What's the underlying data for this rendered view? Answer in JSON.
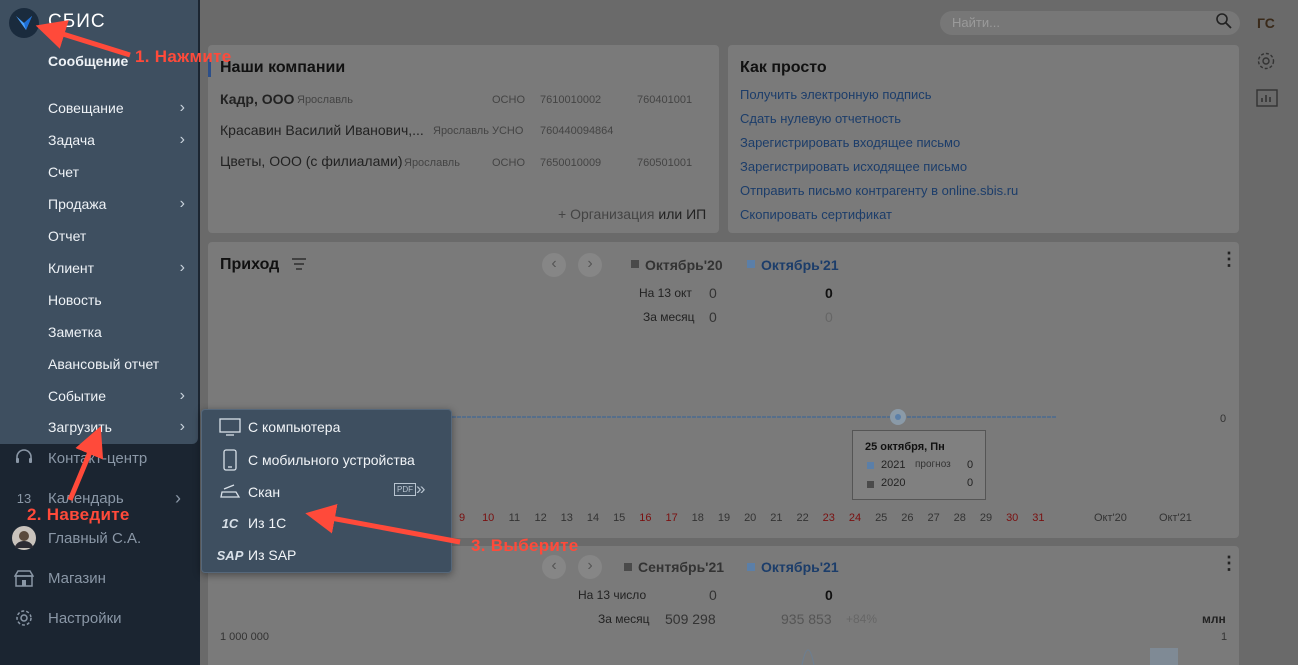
{
  "app": {
    "brand": "СБИС",
    "user_initials": "ГС",
    "search_placeholder": "Найти..."
  },
  "companies": {
    "title": "Наши компании",
    "rows": [
      {
        "name": "Кадр, ООО",
        "city": "Ярославль",
        "tax": "ОСНО",
        "inn": "7610010002",
        "kpp": "760401001"
      },
      {
        "name": "Красавин Василий Иванович,...",
        "city": "Ярославль",
        "tax": "УСНО",
        "inn": "760440094864",
        "kpp": ""
      },
      {
        "name": "Цветы, ООО (с филиалами)",
        "city": "Ярославль",
        "tax": "ОСНО",
        "inn": "7650010009",
        "kpp": "760501001"
      }
    ],
    "add_label": "+ Организация",
    "add_suffix": "или ИП"
  },
  "howto": {
    "title": "Как просто",
    "links": [
      "Получить электронную подпись",
      "Сдать нулевую отчетность",
      "Зарегистрировать входящее письмо",
      "Зарегистрировать исходящее письмо",
      "Отправить письмо контрагенту в online.sbis.ru",
      "Скопировать сертификат"
    ]
  },
  "income": {
    "title": "Приход",
    "col_prev": "Октябрь'20",
    "col_cur": "Октябрь'21",
    "row1_label": "На 13 окт",
    "row1_prev": "0",
    "row1_cur": "0",
    "row2_label": "За месяц",
    "row2_prev": "0",
    "row2_cur": "0",
    "axis_right": "0",
    "tooltip": {
      "title": "25 октября, Пн",
      "r1_year": "2021",
      "r1_note": "прогноз",
      "r1_val": "0",
      "r2_year": "2020",
      "r2_val": "0"
    },
    "days": [
      "9",
      "10",
      "11",
      "12",
      "13",
      "14",
      "15",
      "16",
      "17",
      "18",
      "19",
      "20",
      "21",
      "22",
      "23",
      "24",
      "25",
      "26",
      "27",
      "28",
      "29",
      "30",
      "31"
    ],
    "weekend_days": [
      "9",
      "10",
      "16",
      "17",
      "23",
      "24",
      "30",
      "31"
    ],
    "months": [
      "Окт'20",
      "Окт'21"
    ]
  },
  "second": {
    "col_prev": "Сентябрь'21",
    "col_cur": "Октябрь'21",
    "row1_label": "На 13 число",
    "row1_prev": "0",
    "row1_cur": "0",
    "row2_label": "За месяц",
    "row2_prev": "509 298",
    "row2_cur": "935 853",
    "row2_delta": "+84%",
    "y_left": "1 000 000",
    "unit": "млн",
    "y_right": "1"
  },
  "menu": {
    "items": [
      {
        "label": "Сообщение",
        "arrow": false
      },
      {
        "label": "Совещание",
        "arrow": true
      },
      {
        "label": "Задача",
        "arrow": true
      },
      {
        "label": "Счет",
        "arrow": false
      },
      {
        "label": "Продажа",
        "arrow": true
      },
      {
        "label": "Отчет",
        "arrow": false
      },
      {
        "label": "Клиент",
        "arrow": true
      },
      {
        "label": "Новость",
        "arrow": false
      },
      {
        "label": "Заметка",
        "arrow": false
      },
      {
        "label": "Авансовый отчет",
        "arrow": false
      },
      {
        "label": "Событие",
        "arrow": true
      },
      {
        "label": "Загрузить",
        "arrow": true
      }
    ]
  },
  "submenu": {
    "items": [
      "С компьютера",
      "С мобильного устройства",
      "Скан",
      "Из 1С",
      "Из SAP"
    ],
    "scan_badge": "PDF",
    "icon_1c": "1С",
    "icon_sap": "SAP"
  },
  "sidebar_bottom": [
    "Контакт-центр",
    "Календарь",
    "Главный С.А.",
    "Магазин",
    "Настройки"
  ],
  "calendar_day": "13",
  "annotations": {
    "a1": "1. Нажмите",
    "a2": "2. Наведите",
    "a3": "3. Выберите"
  },
  "colors": {
    "annotation": "#ff4a3a",
    "menu_bg": "#3e4f60",
    "sidebar_bg": "#1b2531"
  }
}
